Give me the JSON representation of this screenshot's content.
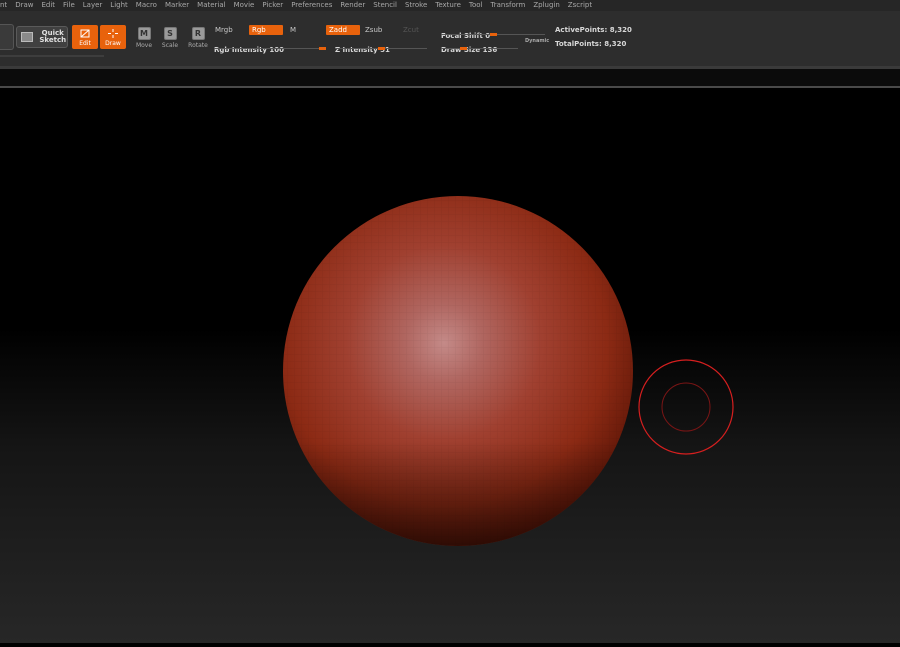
{
  "menu": [
    "nt",
    "Draw",
    "Edit",
    "File",
    "Layer",
    "Light",
    "Macro",
    "Marker",
    "Material",
    "Movie",
    "Picker",
    "Preferences",
    "Render",
    "Stencil",
    "Stroke",
    "Texture",
    "Tool",
    "Transform",
    "Zplugin",
    "Zscript"
  ],
  "toolbar": {
    "quick_sketch": "Quick Sketch",
    "edit": "Edit",
    "draw": "Draw",
    "move": "Move",
    "scale": "Scale",
    "rotate": "Rotate",
    "move_icon": "M",
    "scale_icon": "S",
    "rotate_icon": "R",
    "mrgb": "Mrgb",
    "rgb": "Rgb",
    "m": "M",
    "zadd": "Zadd",
    "zsub": "Zsub",
    "zcut": "Zcut",
    "rgb_intensity": "Rgb Intensity 100",
    "z_intensity": "Z Intensity 51",
    "focal_shift": "Focal Shift 0",
    "draw_size": "Draw Size 136",
    "dynamic": "Dynamic",
    "active_points": "ActivePoints: 8,320",
    "total_points": "TotalPoints: 8,320"
  },
  "sliders": {
    "rgb_intensity": 1.0,
    "z_intensity": 0.51,
    "focal_shift": 0.5,
    "draw_size": 0.27
  },
  "colors": {
    "accent": "#e8620c",
    "sphere": "#a33a2c",
    "cursor": "#d61f1f"
  }
}
